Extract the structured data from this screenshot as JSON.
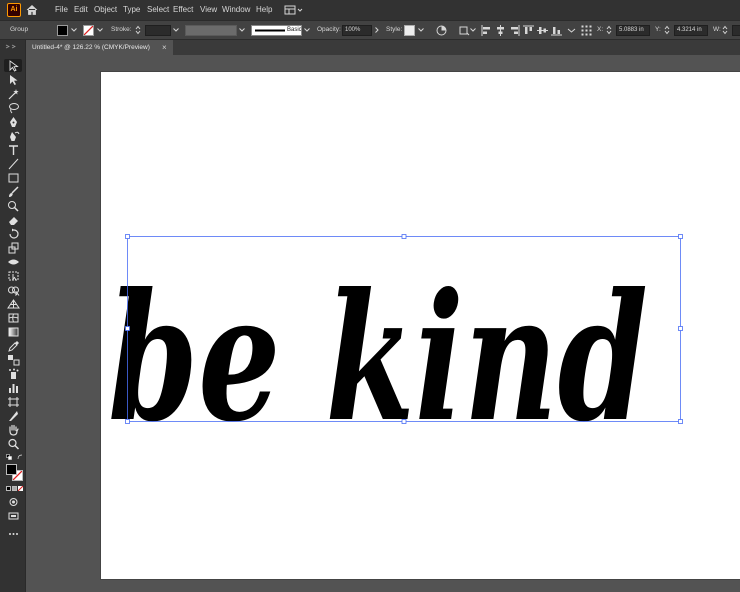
{
  "app": {
    "logo_text": "Ai"
  },
  "menu": [
    "File",
    "Edit",
    "Object",
    "Type",
    "Select",
    "Effect",
    "View",
    "Window",
    "Help"
  ],
  "control_bar": {
    "selection_label": "Group",
    "stroke_label": "Stroke:",
    "brush_label": "Basic",
    "opacity_label": "Opacity:",
    "opacity_value": "100%",
    "style_label": "Style:",
    "x_label": "X:",
    "x_value": "5.0883 in",
    "y_label": "Y:",
    "y_value": "4.3214 in",
    "w_label": "W:"
  },
  "document_tab": {
    "title": "Untitled-4* @ 126.22 % (CMYK/Preview)",
    "close": "×"
  },
  "artwork": {
    "text": "be kind"
  },
  "colors": {
    "accent": "#ff9a00",
    "selection": "#4a6ef5",
    "fill_color": "#000000",
    "stroke_color": "none"
  },
  "tools": [
    "selection-tool-icon",
    "direct-selection-tool-icon",
    "magic-wand-tool-icon",
    "lasso-tool-icon",
    "pen-tool-icon",
    "curvature-tool-icon",
    "type-tool-icon",
    "line-tool-icon",
    "rectangle-tool-icon",
    "paintbrush-tool-icon",
    "shaper-tool-icon",
    "eraser-tool-icon",
    "rotate-tool-icon",
    "scale-tool-icon",
    "width-tool-icon",
    "free-transform-tool-icon",
    "shape-builder-tool-icon",
    "perspective-grid-tool-icon",
    "mesh-tool-icon",
    "gradient-tool-icon",
    "eyedropper-tool-icon",
    "blend-tool-icon",
    "symbol-sprayer-tool-icon",
    "column-graph-tool-icon",
    "artboard-tool-icon",
    "slice-tool-icon",
    "hand-tool-icon",
    "zoom-tool-icon"
  ]
}
